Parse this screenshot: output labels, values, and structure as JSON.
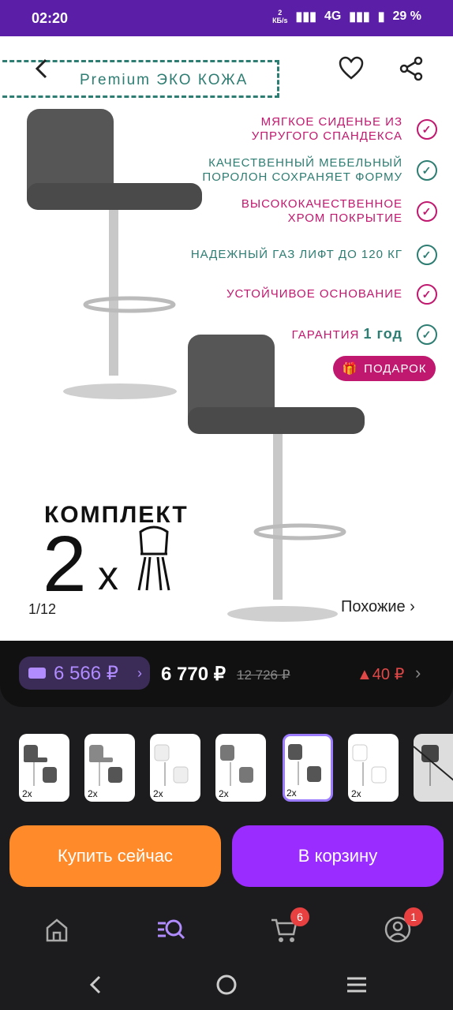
{
  "status": {
    "time": "02:20",
    "speed_top": "2",
    "speed_bottom": "КБ/s",
    "network": "4G",
    "battery": "29 %"
  },
  "product": {
    "label": "Premium ЭКО КОЖА",
    "features": [
      {
        "line1": "МЯГКОЕ СИДЕНЬЕ ИЗ",
        "line2": "УПРУГОГО СПАНДЕКСА",
        "color": "#c0186e"
      },
      {
        "line1": "КАЧЕСТВЕННЫЙ МЕБЕЛЬНЫЙ",
        "line2": "ПОРОЛОН СОХРАНЯЕТ ФОРМУ",
        "color": "#2e7d72"
      },
      {
        "line1": "ВЫСОКОКАЧЕСТВЕННОЕ",
        "line2": "ХРОМ ПОКРЫТИЕ",
        "color": "#c0186e"
      },
      {
        "line1": "НАДЕЖНЫЙ ГАЗ ЛИФТ ДО 120 КГ",
        "line2": "",
        "color": "#2e7d72"
      },
      {
        "line1": "УСТОЙЧИВОЕ ОСНОВАНИЕ",
        "line2": "",
        "color": "#c0186e"
      }
    ],
    "guarantee_prefix": "ГАРАНТИЯ",
    "guarantee_value": "1 год",
    "gift_label": "ПОДАРОК",
    "komplekt": "КОМПЛЕКТ",
    "count": "2",
    "x": "x",
    "pager_current": "1",
    "pager_total": "12",
    "similar": "Похожие ›"
  },
  "pricing": {
    "wallet_price": "6 566 ₽",
    "price": "6 770 ₽",
    "old_price": "12 726 ₽",
    "delta": "▲40 ₽"
  },
  "actions": {
    "buy_label": "Купить сейчас",
    "cart_label": "В корзину"
  },
  "tabbar": {
    "cart_badge": "6",
    "profile_badge": "1"
  },
  "colors": {
    "accent": "#9b2cff",
    "buy": "#ff8a2a",
    "pink": "#c0186e",
    "teal": "#2e7d72"
  }
}
